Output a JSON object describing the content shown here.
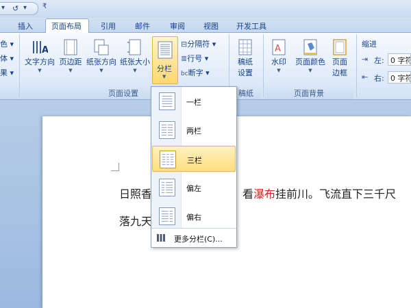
{
  "tabs": [
    {
      "label": "插入"
    },
    {
      "label": "页面布局"
    },
    {
      "label": "引用"
    },
    {
      "label": "邮件"
    },
    {
      "label": "审阅"
    },
    {
      "label": "视图"
    },
    {
      "label": "开发工具"
    }
  ],
  "ribbon": {
    "theme_partial": [
      "色 ▾",
      "体 ▾",
      "果 ▾"
    ],
    "page_setup": {
      "group_label": "页面设置",
      "text_direction": "文字方向",
      "margins": "页边距",
      "orientation": "纸张方向",
      "size": "纸张大小",
      "columns": "分栏",
      "breaks": "分隔符 ▾",
      "line_numbers": "行号 ▾",
      "hyphenation": "断字 ▾"
    },
    "manuscript": {
      "group_label": "稿纸",
      "settings": "稿纸",
      "settings2": "设置"
    },
    "page_background": {
      "group_label": "页面背景",
      "watermark": "水印",
      "page_color": "页面颜色",
      "borders": "页面",
      "borders2": "边框"
    },
    "indent": {
      "title": "缩进",
      "left_label": "左:",
      "left_value": "0 字符",
      "right_label": "右:",
      "right_value": "0 字符"
    }
  },
  "columns_menu": {
    "items": [
      {
        "label": "一栏"
      },
      {
        "label": "两栏"
      },
      {
        "label": "三栏"
      },
      {
        "label": "偏左"
      },
      {
        "label": "偏右"
      }
    ],
    "more": "更多分栏(C)..."
  },
  "document": {
    "line1_pre": "日照香",
    "line1_mid": "看",
    "line1_red": "瀑布",
    "line1_post": "挂前川。飞流直下三千尺",
    "line2": "落九天"
  },
  "colors": {
    "accent_text": "#15428b",
    "highlight": "#ffd76e",
    "red_text": "#e02020"
  }
}
